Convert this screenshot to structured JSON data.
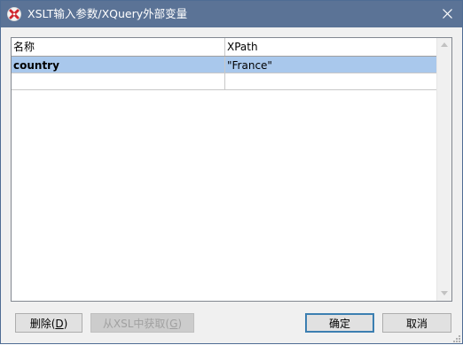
{
  "window": {
    "title": "XSLT输入参数/XQuery外部变量"
  },
  "icons": {
    "app": "altova-app-icon",
    "close": "close-icon"
  },
  "grid": {
    "columns": [
      "名称",
      "XPath"
    ],
    "rows": [
      {
        "name": "country",
        "xpath": "\"France\"",
        "selected": true
      },
      {
        "name": "",
        "xpath": "",
        "selected": false
      }
    ]
  },
  "buttons": {
    "delete_label": "删除(",
    "delete_key": "D",
    "delete_suffix": ")",
    "fromxsl_label": "从XSL中获取(",
    "fromxsl_key": "G",
    "fromxsl_suffix": ")",
    "ok_label": "确定",
    "cancel_label": "取消"
  },
  "colors": {
    "titlebar": "#5b7396",
    "selection": "#a9c8ec",
    "default_button_border": "#3c7fb1"
  }
}
